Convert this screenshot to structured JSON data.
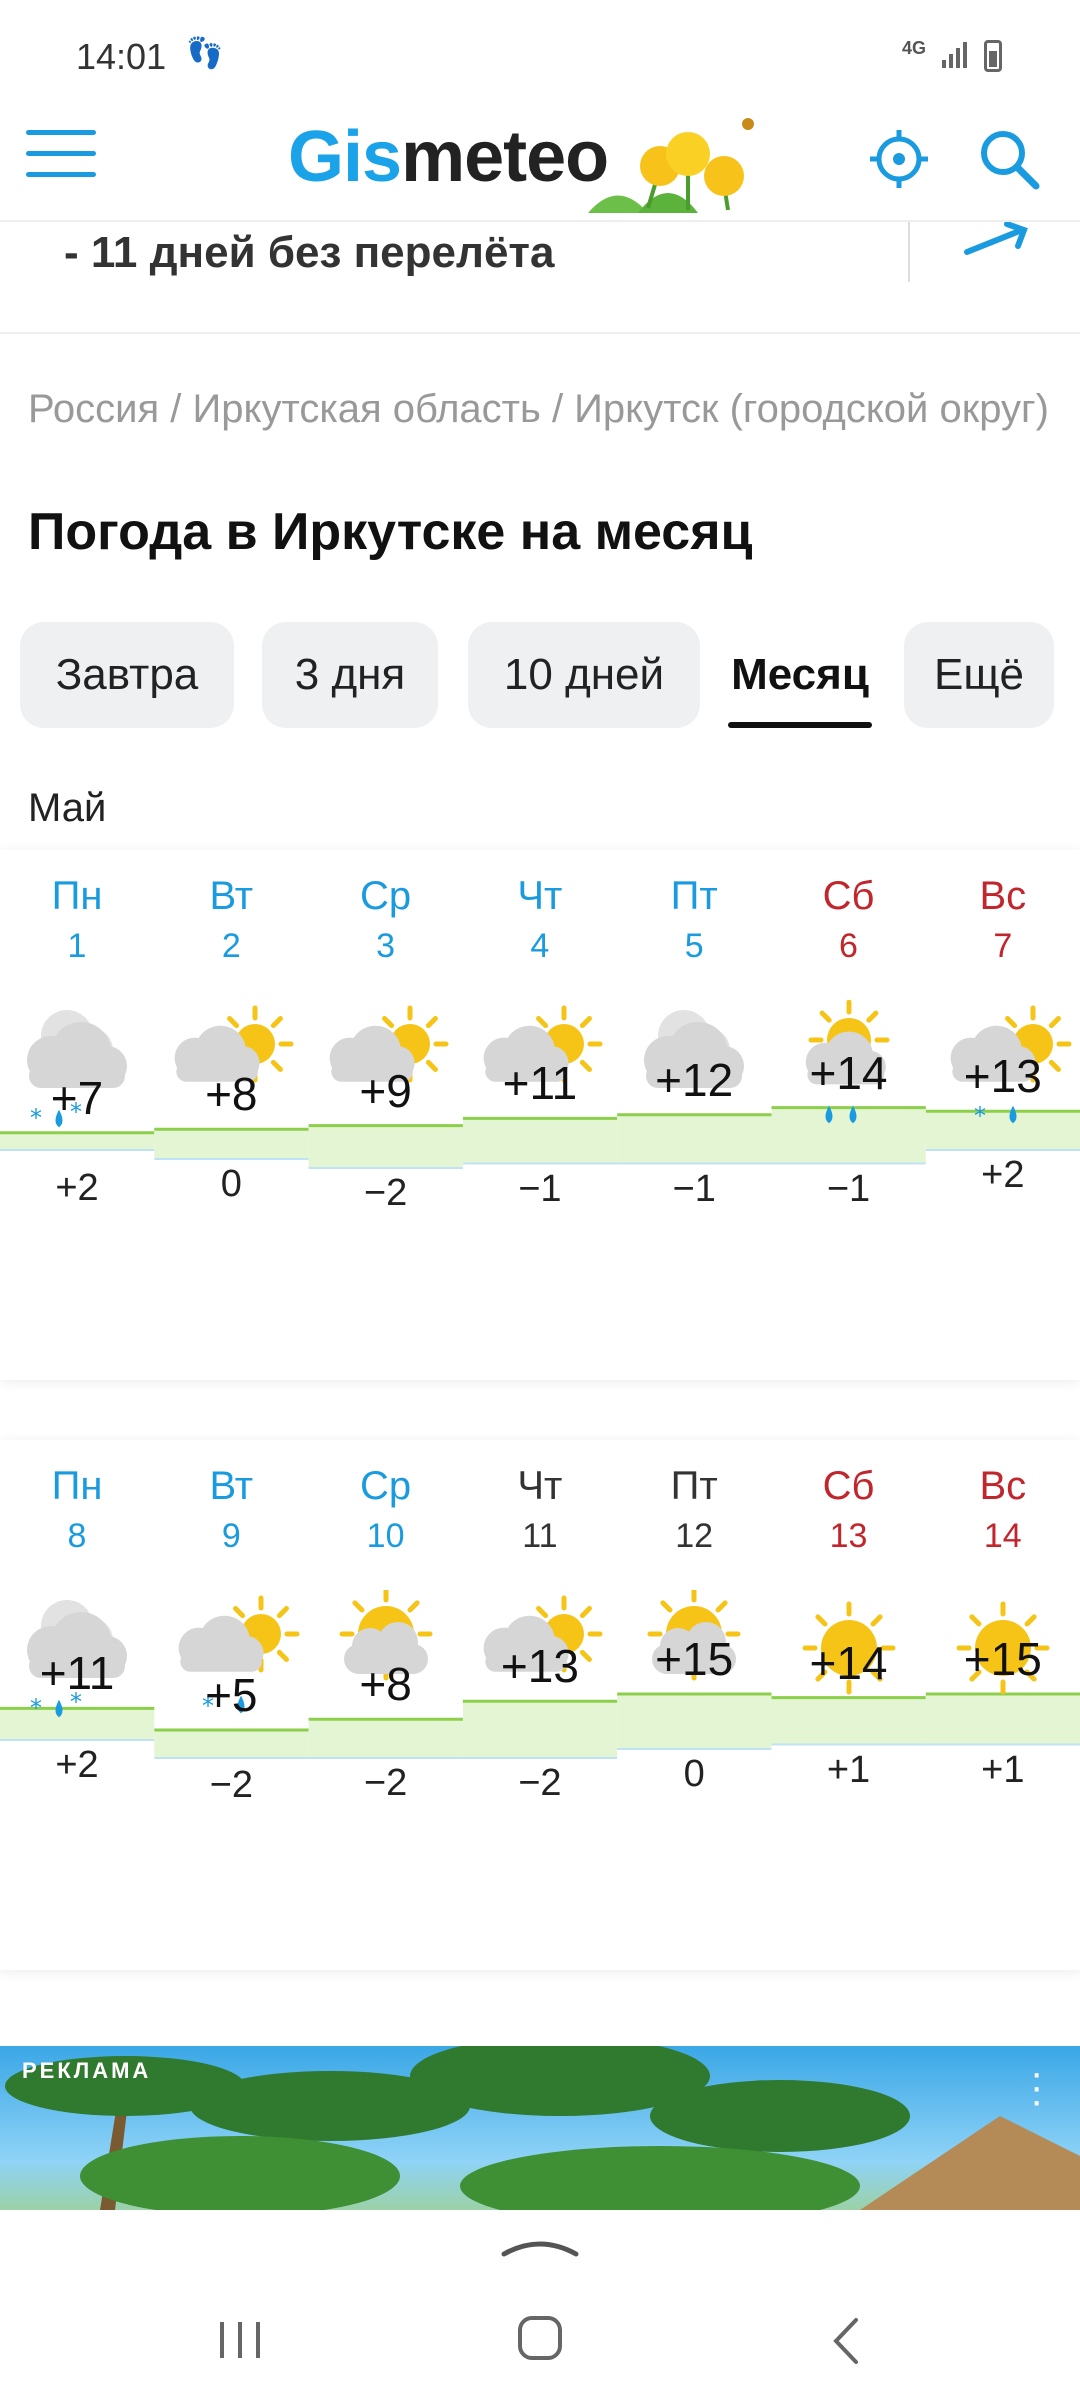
{
  "status_bar": {
    "time": "14:01",
    "network": "4G"
  },
  "header": {
    "logo_part1": "Gis",
    "logo_part2": "meteo"
  },
  "promo": {
    "text": "- 11 дней без перелёта"
  },
  "breadcrumb": {
    "text": "Россия / Иркутская область / Иркутск (городской округ)"
  },
  "page_title": "Погода в Иркутске на месяц",
  "tabs": [
    {
      "label": "Завтра"
    },
    {
      "label": "3 дня"
    },
    {
      "label": "10 дней"
    },
    {
      "label": "Месяц"
    },
    {
      "label": "Ещё"
    }
  ],
  "month_label": "Май",
  "weeks": [
    {
      "days": [
        {
          "name": "Пн",
          "date": "1",
          "color": "blue",
          "icon": "cloud-rain-snow-icon",
          "tmax": "+7",
          "tmin": "+2"
        },
        {
          "name": "Вт",
          "date": "2",
          "color": "blue",
          "icon": "partly-cloudy-icon",
          "tmax": "+8",
          "tmin": "0"
        },
        {
          "name": "Ср",
          "date": "3",
          "color": "blue",
          "icon": "partly-cloudy-icon",
          "tmax": "+9",
          "tmin": "−2"
        },
        {
          "name": "Чт",
          "date": "4",
          "color": "blue",
          "icon": "partly-cloudy-icon",
          "tmax": "+11",
          "tmin": "−1"
        },
        {
          "name": "Пт",
          "date": "5",
          "color": "blue",
          "icon": "cloudy-icon",
          "tmax": "+12",
          "tmin": "−1"
        },
        {
          "name": "Сб",
          "date": "6",
          "color": "red",
          "icon": "sun-cloud-rain-icon",
          "tmax": "+14",
          "tmin": "−1"
        },
        {
          "name": "Вс",
          "date": "7",
          "color": "red",
          "icon": "sun-cloud-rain-snow-icon",
          "tmax": "+13",
          "tmin": "+2"
        }
      ]
    },
    {
      "days": [
        {
          "name": "Пн",
          "date": "8",
          "color": "blue",
          "icon": "cloud-rain-snow-icon",
          "tmax": "+11",
          "tmin": "+2"
        },
        {
          "name": "Вт",
          "date": "9",
          "color": "blue",
          "icon": "sun-cloud-rain-snow-icon",
          "tmax": "+5",
          "tmin": "−2"
        },
        {
          "name": "Ср",
          "date": "10",
          "color": "blue",
          "icon": "sun-behind-cloud-icon",
          "tmax": "+8",
          "tmin": "−2"
        },
        {
          "name": "Чт",
          "date": "11",
          "color": "black",
          "icon": "partly-cloudy-icon",
          "tmax": "+13",
          "tmin": "−2"
        },
        {
          "name": "Пт",
          "date": "12",
          "color": "black",
          "icon": "sun-behind-cloud-icon",
          "tmax": "+15",
          "tmin": "0"
        },
        {
          "name": "Сб",
          "date": "13",
          "color": "red",
          "icon": "sun-icon",
          "tmax": "+14",
          "tmin": "+1"
        },
        {
          "name": "Вс",
          "date": "14",
          "color": "red",
          "icon": "sun-icon",
          "tmax": "+15",
          "tmin": "+1"
        }
      ]
    }
  ],
  "ad": {
    "label": "РЕКЛАМА"
  },
  "colors": {
    "accent": "#1a9be0",
    "weekend": "#c0262c",
    "temp_fill": "#e4f5d4",
    "temp_line": "#8ccf4a"
  }
}
